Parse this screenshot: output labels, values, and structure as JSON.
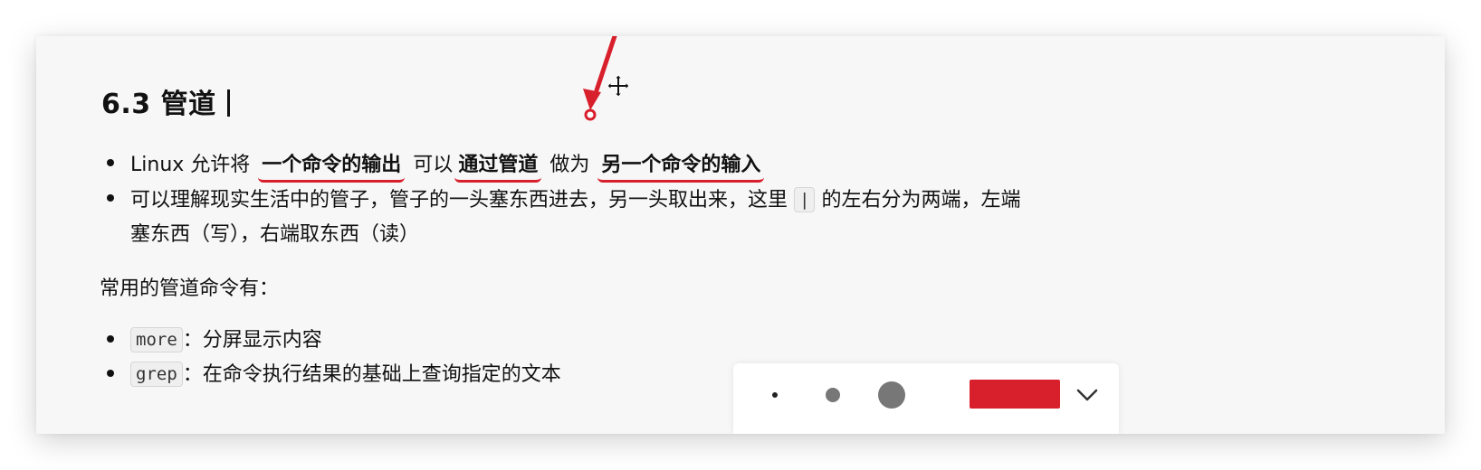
{
  "heading": {
    "title": "6.3 管道"
  },
  "bullets_top": [
    {
      "parts": [
        "Linux 允许将",
        "一个命令的输出",
        "可以",
        "通过管道",
        "做为",
        "另一个命令的输入"
      ]
    },
    {
      "line1": {
        "before": "可以理解现实生活中的管子，管子的一头塞东西进去，另一头取出来，这里",
        "code": "|",
        "after": "的左右分为两端，左端"
      },
      "line2": "塞东西（写），右端取东西（读）"
    }
  ],
  "section_label": "常用的管道命令有：",
  "commands": [
    {
      "code": "more",
      "desc": "：分屏显示内容"
    },
    {
      "code": "grep",
      "desc": "：在命令执行结果的基础上查询指定的文本"
    }
  ],
  "annotation": {
    "arrow_color": "#d8202d",
    "underline_color": "#d8202d"
  },
  "toolbar": {
    "selected_color": "#d8202d",
    "sizes": [
      "small",
      "medium",
      "large"
    ]
  }
}
